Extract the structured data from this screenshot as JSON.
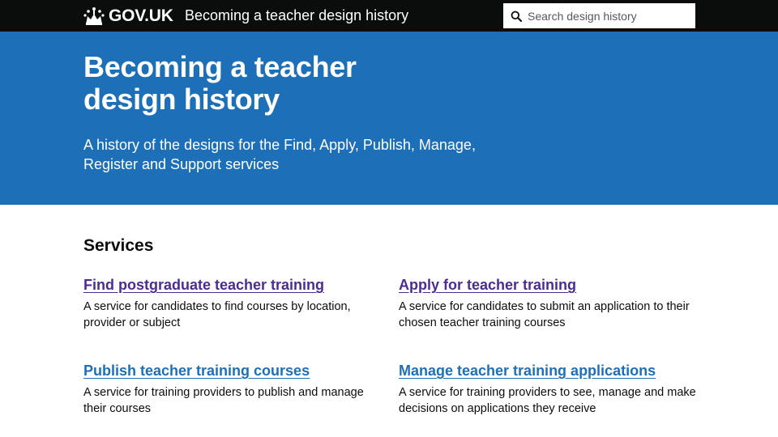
{
  "header": {
    "logo_text": "GOV.UK",
    "service_name": "Becoming a teacher design history",
    "search": {
      "placeholder": "Search design history",
      "value": ""
    }
  },
  "hero": {
    "title": "Becoming a teacher design history",
    "description": "A history of the designs for the Find, Apply, Publish, Manage, Register and Support services"
  },
  "services": {
    "heading": "Services",
    "items": [
      {
        "title": "Find postgraduate teacher training",
        "description": "A service for candidates to find courses by location, provider or subject",
        "visited": true
      },
      {
        "title": "Apply for teacher training",
        "description": "A service for candidates to submit an application to their chosen teacher training courses",
        "visited": true
      },
      {
        "title": "Publish teacher training courses",
        "description": "A service for training providers to publish and manage their courses",
        "visited": false
      },
      {
        "title": "Manage teacher training applications",
        "description": "A service for training providers to see, manage and make decisions on applications they receive",
        "visited": false
      }
    ]
  },
  "colors": {
    "header_bg": "#0b0c0c",
    "hero_bg": "#1d70b8",
    "link": "#1d70b8",
    "visited_link": "#4c2c92"
  },
  "icons": {
    "logo": "crown-icon",
    "search": "search-icon"
  }
}
